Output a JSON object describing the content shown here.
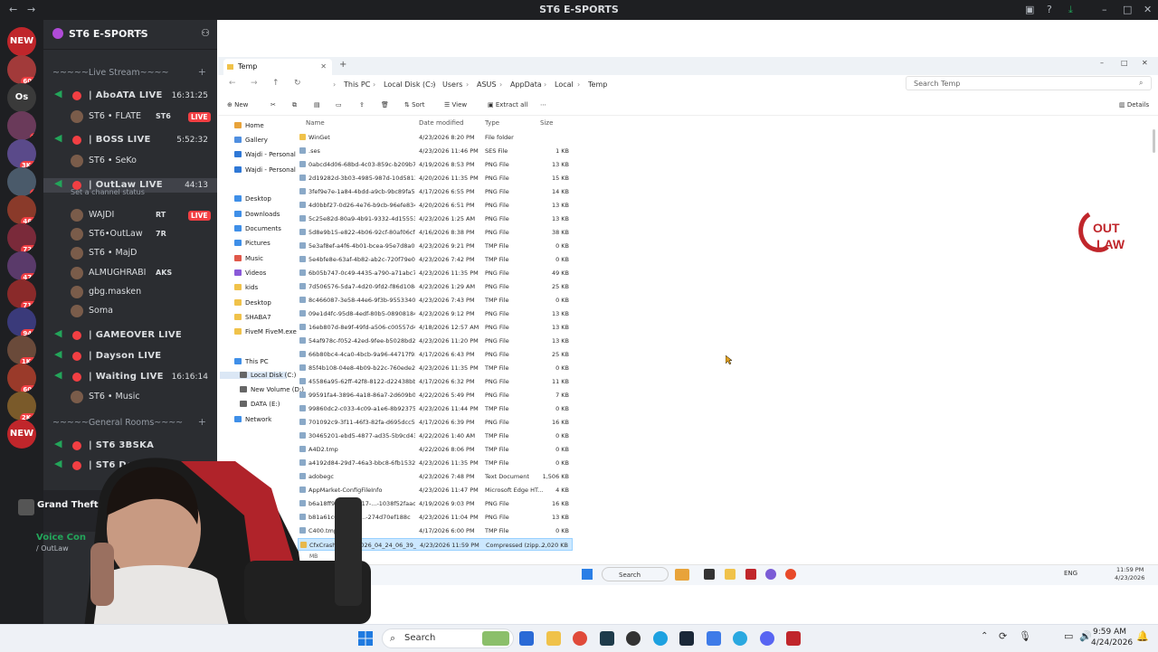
{
  "discord": {
    "window_title": "ST6 E-SPORTS",
    "server_name": "ST6 E-SPORTS",
    "rail": [
      {
        "label": "NEW",
        "badge": ""
      },
      {
        "label": "",
        "badge": "601"
      },
      {
        "label": "Os",
        "badge": ""
      },
      {
        "label": "",
        "badge": "7"
      },
      {
        "label": "",
        "badge": "3K+"
      },
      {
        "label": "",
        "badge": "9"
      },
      {
        "label": "",
        "badge": "466"
      },
      {
        "label": "",
        "badge": "723"
      },
      {
        "label": "",
        "badge": "474"
      },
      {
        "label": "",
        "badge": "719"
      },
      {
        "label": "",
        "badge": "948"
      },
      {
        "label": "",
        "badge": "1K+"
      },
      {
        "label": "",
        "badge": "604"
      },
      {
        "label": "",
        "badge": "2K+"
      },
      {
        "label": "NEW",
        "badge": ""
      }
    ],
    "categories": {
      "live_stream": "Live Stream",
      "general_rooms": "General Rooms"
    },
    "channels": [
      {
        "name": "| AboATA LIVE",
        "timer": "16:31:25"
      },
      {
        "name": "| BOSS LIVE",
        "timer": "5:52:32"
      },
      {
        "name": "| OutLaw LIVE",
        "timer": "44:13"
      },
      {
        "name": "| GAMEOVER LIVE",
        "timer": ""
      },
      {
        "name": "| Dayson LIVE",
        "timer": ""
      },
      {
        "name": "| Waiting LIVE",
        "timer": "16:16:14"
      },
      {
        "name": "| ST6 3BSKA",
        "timer": ""
      },
      {
        "name": "| ST6 DoK",
        "timer": ""
      }
    ],
    "channel_status": "Set a channel status",
    "members": [
      {
        "name": "ST6 • FLATE",
        "tag": "ST6",
        "live": "LIVE"
      },
      {
        "name": "ST6 • SeKo",
        "tag": "",
        "live": ""
      },
      {
        "name": "WAJDI",
        "tag": "RT",
        "live": "LIVE"
      },
      {
        "name": "ST6•OutLaw",
        "tag": "7R",
        "live": ""
      },
      {
        "name": "ST6 • MajD",
        "tag": "",
        "live": ""
      },
      {
        "name": "ALMUGHRABI",
        "tag": "AKS",
        "live": ""
      },
      {
        "name": "gbg.masken",
        "tag": "",
        "live": ""
      },
      {
        "name": "Soma",
        "tag": "",
        "live": ""
      },
      {
        "name": "ST6 • Music",
        "tag": "",
        "live": ""
      }
    ],
    "game_activity": "Grand Theft Aut",
    "voice_connected": "Voice Con",
    "voice_sub": "/ OutLaw"
  },
  "explorer": {
    "tab_title": "Temp",
    "breadcrumb": [
      "This PC",
      "Local Disk (C:)",
      "Users",
      "ASUS",
      "AppData",
      "Local",
      "Temp"
    ],
    "search_placeholder": "Search Temp",
    "commands": {
      "new": "New",
      "sort": "Sort",
      "view": "View",
      "extract": "Extract all",
      "details": "Details"
    },
    "nav": [
      {
        "label": "Home",
        "color": "#e8a33a"
      },
      {
        "label": "Gallery",
        "color": "#4f8fe0"
      },
      {
        "label": "Wajdi - Personal",
        "color": "#2f78d6"
      },
      {
        "label": "Wajdi - Personal",
        "color": "#2f78d6"
      },
      {
        "label": "Desktop",
        "color": "#3f8fe8"
      },
      {
        "label": "Downloads",
        "color": "#3f8fe8"
      },
      {
        "label": "Documents",
        "color": "#3f8fe8"
      },
      {
        "label": "Pictures",
        "color": "#3f8fe8"
      },
      {
        "label": "Music",
        "color": "#e0584a"
      },
      {
        "label": "Videos",
        "color": "#8a5ad8"
      },
      {
        "label": "kids",
        "color": "#f0c24a"
      },
      {
        "label": "Desktop",
        "color": "#f0c24a"
      },
      {
        "label": "SHABA7",
        "color": "#f0c24a"
      },
      {
        "label": "FiveM FiveM.exe",
        "color": "#f0c24a"
      },
      {
        "label": "This PC",
        "color": "#3f8fe8"
      },
      {
        "label": "Local Disk (C:)",
        "color": "#666666"
      },
      {
        "label": "New Volume (D:)",
        "color": "#666666"
      },
      {
        "label": "DATA (E:)",
        "color": "#666666"
      },
      {
        "label": "Network",
        "color": "#3f8fe8"
      }
    ],
    "columns": {
      "name": "Name",
      "date": "Date modified",
      "type": "Type",
      "size": "Size"
    },
    "files": [
      {
        "name": "WinGet",
        "date": "4/23/2026 8:20 PM",
        "type": "File folder",
        "size": ""
      },
      {
        "name": ".ses",
        "date": "4/23/2026 11:46 PM",
        "type": "SES File",
        "size": "1 KB"
      },
      {
        "name": "0abcd4d06-68bd-4c03-859c-b209b7729b...",
        "date": "4/19/2026 8:53 PM",
        "type": "PNG File",
        "size": "13 KB"
      },
      {
        "name": "2d19282d-3b03-4985-987d-10d58137c7f3",
        "date": "4/20/2026 11:35 PM",
        "type": "PNG File",
        "size": "15 KB"
      },
      {
        "name": "3fef9e7e-1a84-4bdd-a9cb-9bc89fa5c4a",
        "date": "4/17/2026 6:55 PM",
        "type": "PNG File",
        "size": "14 KB"
      },
      {
        "name": "4d0bbf27-0d26-4e76-b9cb-96efe8349bac",
        "date": "4/20/2026 6:51 PM",
        "type": "PNG File",
        "size": "13 KB"
      },
      {
        "name": "5c25e82d-80a9-4b91-9332-4d1555375167",
        "date": "4/23/2026 1:25 AM",
        "type": "PNG File",
        "size": "13 KB"
      },
      {
        "name": "5d8e9b15-e822-4b06-92cf-80af06cf466b",
        "date": "4/16/2026 8:38 PM",
        "type": "PNG File",
        "size": "38 KB"
      },
      {
        "name": "5e3af8ef-a4f6-4b01-bcea-95e7d8a02b6...",
        "date": "4/23/2026 9:21 PM",
        "type": "TMP File",
        "size": "0 KB"
      },
      {
        "name": "5e4bfe8e-63af-4b82-ab2c-720f79e065e8...",
        "date": "4/23/2026 7:42 PM",
        "type": "TMP File",
        "size": "0 KB"
      },
      {
        "name": "6b05b747-0c49-4435-a790-a71abc722470",
        "date": "4/23/2026 11:35 PM",
        "type": "PNG File",
        "size": "49 KB"
      },
      {
        "name": "7d506576-5da7-4d20-9fd2-f86d10848712",
        "date": "4/23/2026 1:29 AM",
        "type": "PNG File",
        "size": "25 KB"
      },
      {
        "name": "8c466087-3e58-44e6-9f3b-95533400be...",
        "date": "4/23/2026 7:43 PM",
        "type": "TMP File",
        "size": "0 KB"
      },
      {
        "name": "09e1d4fc-95d8-4edf-80b5-089081847502",
        "date": "4/23/2026 9:12 PM",
        "type": "PNG File",
        "size": "13 KB"
      },
      {
        "name": "16eb807d-8e9f-49fd-a506-c00557d4c5ee",
        "date": "4/18/2026 12:57 AM",
        "type": "PNG File",
        "size": "13 KB"
      },
      {
        "name": "54af978c-f052-42ed-9fee-b5028bd28deb",
        "date": "4/23/2026 11:20 PM",
        "type": "PNG File",
        "size": "13 KB"
      },
      {
        "name": "66b80bc4-4ca0-4bcb-9a96-44717f93e197",
        "date": "4/17/2026 6:43 PM",
        "type": "PNG File",
        "size": "25 KB"
      },
      {
        "name": "85f4b108-04e8-4b09-b22c-760ede2d2b...",
        "date": "4/23/2026 11:35 PM",
        "type": "TMP File",
        "size": "0 KB"
      },
      {
        "name": "45586a95-62ff-42f8-8122-d22438bbe4db",
        "date": "4/17/2026 6:32 PM",
        "type": "PNG File",
        "size": "11 KB"
      },
      {
        "name": "99591fa4-3896-4a18-86a7-2d609b02c8f2",
        "date": "4/22/2026 5:49 PM",
        "type": "PNG File",
        "size": "7 KB"
      },
      {
        "name": "99860dc2-c033-4c09-a1e6-8b92375228e...",
        "date": "4/23/2026 11:44 PM",
        "type": "TMP File",
        "size": "0 KB"
      },
      {
        "name": "701092c9-3f11-46f3-82fa-d695dcc51441",
        "date": "4/17/2026 6:39 PM",
        "type": "PNG File",
        "size": "16 KB"
      },
      {
        "name": "30465201-ebd5-4877-ad35-5b9cd43d41...",
        "date": "4/22/2026 1:40 AM",
        "type": "TMP File",
        "size": "0 KB"
      },
      {
        "name": "A4D2.tmp",
        "date": "4/22/2026 8:06 PM",
        "type": "TMP File",
        "size": "0 KB"
      },
      {
        "name": "a4192d84-29d7-46a3-bbc8-6fb1532da1...",
        "date": "4/23/2026 11:35 PM",
        "type": "TMP File",
        "size": "0 KB"
      },
      {
        "name": "adobegc",
        "date": "4/23/2026 7:48 PM",
        "type": "Text Document",
        "size": "1,506 KB"
      },
      {
        "name": "AppMarket-ConfigFileInfo",
        "date": "4/23/2026 11:47 PM",
        "type": "Microsoft Edge HT...",
        "size": "4 KB"
      },
      {
        "name": "b6a18ff9-d171-4317-...-1038f52faac4",
        "date": "4/19/2026 9:03 PM",
        "type": "PNG File",
        "size": "16 KB"
      },
      {
        "name": "b81a61c0-e98c-4...-274d70ef188c",
        "date": "4/23/2026 11:04 PM",
        "type": "PNG File",
        "size": "13 KB"
      },
      {
        "name": "C400.tmp",
        "date": "4/17/2026 6:00 PM",
        "type": "TMP File",
        "size": "0 KB"
      },
      {
        "name": "CfxCrashDump_2026_04_24_06_39_14",
        "date": "4/23/2026 11:59 PM",
        "type": "Compressed (zipp...",
        "size": "2,020 KB"
      }
    ],
    "status_tail": "MB",
    "inner_taskbar": {
      "search": "Search",
      "lang": "ENG",
      "time": "11:59 PM",
      "date": "4/23/2026"
    }
  },
  "taskbar": {
    "search": "Search",
    "time": "9:59 AM",
    "date": "4/24/2026"
  },
  "logo_text": "OUT LAW"
}
